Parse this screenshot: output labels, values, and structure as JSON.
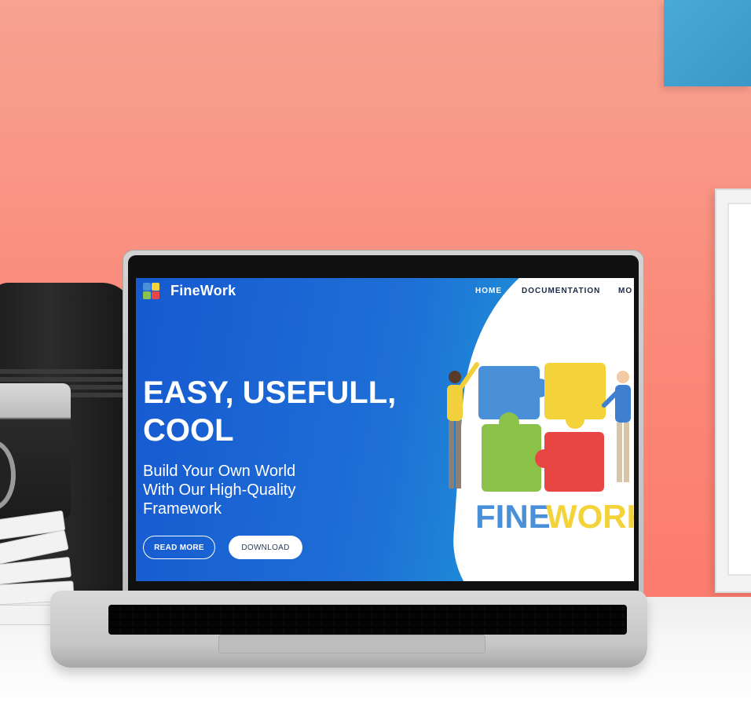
{
  "site": {
    "brand": "FineWork",
    "nav": {
      "home": "HOME",
      "documentation": "DOCUMENTATION",
      "more": "MO"
    },
    "hero": {
      "title_line1": "EASY, USEFULL,",
      "title_line2": "COOL",
      "subtitle_line1": "Build Your Own World",
      "subtitle_line2": "With Our High-Quality",
      "subtitle_line3": "Framework",
      "read_more": "READ MORE",
      "download": "DOWNLOAD"
    },
    "illustration": {
      "word_fine": "FINE",
      "word_work": "WORK"
    }
  },
  "colors": {
    "wall": "#fc8a7a",
    "hero_blue": "#1659d0",
    "puzzle_blue": "#4a90d9",
    "puzzle_yellow": "#f4d23a",
    "puzzle_green": "#8bc34a",
    "puzzle_red": "#e84545"
  }
}
